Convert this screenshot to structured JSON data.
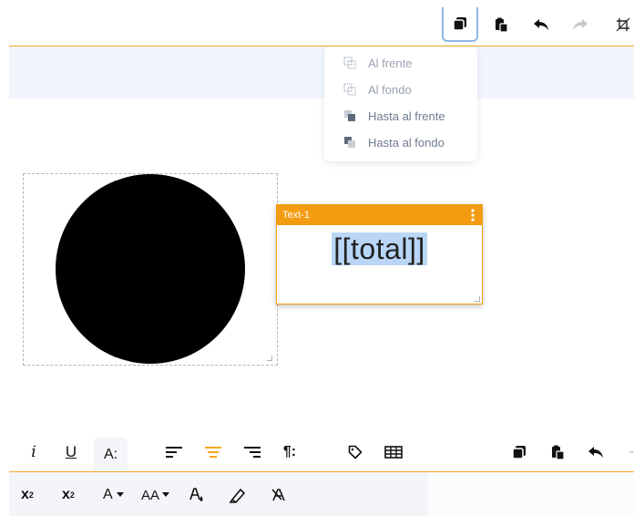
{
  "colors": {
    "accent": "#f5a623",
    "selection_blue": "#b9d6f7",
    "active_border": "#8fb8e6",
    "shape_fill": "#000000"
  },
  "top_toolbar": {
    "icons": [
      "copy-style-icon",
      "paste-icon",
      "undo-icon",
      "redo-icon",
      "crop-icon"
    ]
  },
  "arrange_menu": {
    "items": [
      {
        "label": "Al frente",
        "icon": "bring-forward-icon",
        "state": "disabled"
      },
      {
        "label": "Al fondo",
        "icon": "send-backward-icon",
        "state": "disabled"
      },
      {
        "label": "Hasta al frente",
        "icon": "bring-to-front-icon",
        "state": "enabled"
      },
      {
        "label": "Hasta al fondo",
        "icon": "send-to-back-icon",
        "state": "enabled"
      }
    ]
  },
  "canvas": {
    "shape": {
      "type": "circle"
    },
    "text_element": {
      "name": "Text-1",
      "content": "[[total]]"
    }
  },
  "text_toolbar": {
    "row1": {
      "italic": "i",
      "underline": "U",
      "font_size": "A:",
      "align_left_icon": "align-left-icon",
      "align_center_icon": "align-center-icon",
      "align_right_icon": "align-right-icon",
      "paragraph": "¶:",
      "tag_icon": "tag-icon",
      "table_icon": "table-icon",
      "copy_icon": "copy-style-icon",
      "paste_icon": "paste-icon",
      "undo_icon": "undo-icon"
    },
    "row2": {
      "subscript_base": "x",
      "subscript_mark": "2",
      "superscript_base": "x",
      "superscript_mark": "2",
      "font_color": "A",
      "text_case": "AA",
      "fill_icon": "fill-color-icon",
      "highlight_icon": "highlighter-icon",
      "clear_format_icon": "clear-format-icon"
    }
  }
}
